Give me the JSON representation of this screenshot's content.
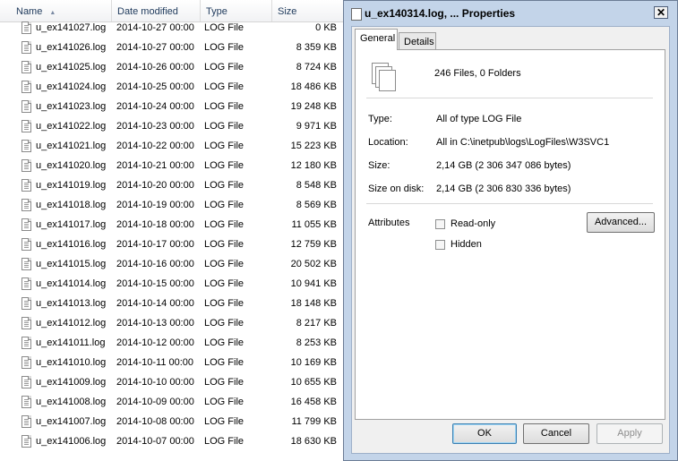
{
  "list": {
    "columns": {
      "name": "Name",
      "date": "Date modified",
      "type": "Type",
      "size": "Size"
    },
    "rows": [
      {
        "name": "u_ex141027.log",
        "date": "2014-10-27 00:00",
        "type": "LOG File",
        "size": "0 KB"
      },
      {
        "name": "u_ex141026.log",
        "date": "2014-10-27 00:00",
        "type": "LOG File",
        "size": "8 359 KB"
      },
      {
        "name": "u_ex141025.log",
        "date": "2014-10-26 00:00",
        "type": "LOG File",
        "size": "8 724 KB"
      },
      {
        "name": "u_ex141024.log",
        "date": "2014-10-25 00:00",
        "type": "LOG File",
        "size": "18 486 KB"
      },
      {
        "name": "u_ex141023.log",
        "date": "2014-10-24 00:00",
        "type": "LOG File",
        "size": "19 248 KB"
      },
      {
        "name": "u_ex141022.log",
        "date": "2014-10-23 00:00",
        "type": "LOG File",
        "size": "9 971 KB"
      },
      {
        "name": "u_ex141021.log",
        "date": "2014-10-22 00:00",
        "type": "LOG File",
        "size": "15 223 KB"
      },
      {
        "name": "u_ex141020.log",
        "date": "2014-10-21 00:00",
        "type": "LOG File",
        "size": "12 180 KB"
      },
      {
        "name": "u_ex141019.log",
        "date": "2014-10-20 00:00",
        "type": "LOG File",
        "size": "8 548 KB"
      },
      {
        "name": "u_ex141018.log",
        "date": "2014-10-19 00:00",
        "type": "LOG File",
        "size": "8 569 KB"
      },
      {
        "name": "u_ex141017.log",
        "date": "2014-10-18 00:00",
        "type": "LOG File",
        "size": "11 055 KB"
      },
      {
        "name": "u_ex141016.log",
        "date": "2014-10-17 00:00",
        "type": "LOG File",
        "size": "12 759 KB"
      },
      {
        "name": "u_ex141015.log",
        "date": "2014-10-16 00:00",
        "type": "LOG File",
        "size": "20 502 KB"
      },
      {
        "name": "u_ex141014.log",
        "date": "2014-10-15 00:00",
        "type": "LOG File",
        "size": "10 941 KB"
      },
      {
        "name": "u_ex141013.log",
        "date": "2014-10-14 00:00",
        "type": "LOG File",
        "size": "18 148 KB"
      },
      {
        "name": "u_ex141012.log",
        "date": "2014-10-13 00:00",
        "type": "LOG File",
        "size": "8 217 KB"
      },
      {
        "name": "u_ex141011.log",
        "date": "2014-10-12 00:00",
        "type": "LOG File",
        "size": "8 253 KB"
      },
      {
        "name": "u_ex141010.log",
        "date": "2014-10-11 00:00",
        "type": "LOG File",
        "size": "10 169 KB"
      },
      {
        "name": "u_ex141009.log",
        "date": "2014-10-10 00:00",
        "type": "LOG File",
        "size": "10 655 KB"
      },
      {
        "name": "u_ex141008.log",
        "date": "2014-10-09 00:00",
        "type": "LOG File",
        "size": "16 458 KB"
      },
      {
        "name": "u_ex141007.log",
        "date": "2014-10-08 00:00",
        "type": "LOG File",
        "size": "11 799 KB"
      },
      {
        "name": "u_ex141006.log",
        "date": "2014-10-07 00:00",
        "type": "LOG File",
        "size": "18 630 KB"
      }
    ]
  },
  "dialog": {
    "title": "u_ex140314.log, ... Properties",
    "close_glyph": "✕",
    "tabs": {
      "general": "General",
      "details": "Details"
    },
    "summary": "246 Files, 0 Folders",
    "type_label": "Type:",
    "type_value": "All of type LOG File",
    "location_label": "Location:",
    "location_value": "All in C:\\inetpub\\logs\\LogFiles\\W3SVC1",
    "size_label": "Size:",
    "size_value": "2,14 GB (2 306 347 086 bytes)",
    "sizeondisk_label": "Size on disk:",
    "sizeondisk_value": "2,14 GB (2 306 830 336 bytes)",
    "attributes_label": "Attributes",
    "readonly_label": "Read-only",
    "hidden_label": "Hidden",
    "advanced_label": "Advanced...",
    "ok_label": "OK",
    "cancel_label": "Cancel",
    "apply_label": "Apply"
  },
  "colors": {
    "dialog_frame": "#c3d4e9",
    "header_text": "#1e395b"
  }
}
